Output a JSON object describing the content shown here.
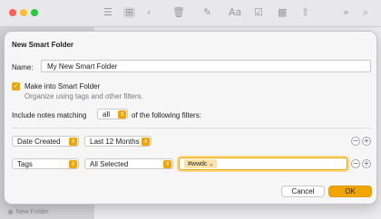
{
  "background": {
    "toolbar_icons": [
      "list-view-icon",
      "gallery-view-icon",
      "back-icon",
      "trash-icon",
      "compose-icon",
      "font-icon",
      "checklist-icon",
      "table-icon",
      "share-icon",
      "more-icon",
      "search-icon"
    ],
    "sidebar_new_folder_label": "New Folder",
    "new_folder_icon_glyph": "⊕"
  },
  "dialog": {
    "title": "New Smart Folder",
    "name_label": "Name:",
    "name_value": "My New Smart Folder",
    "smart_folder_checked": true,
    "smart_folder_label": "Make into Smart Folder",
    "smart_folder_hint": "Organize using tags and other filters.",
    "match_prefix": "Include notes matching",
    "match_value": "all",
    "match_suffix": "of the following filters:",
    "filters": [
      {
        "field": "Date Created",
        "value": "Last 12 Months"
      },
      {
        "field": "Tags",
        "value": "All Selected",
        "tokens": [
          "#wwdc"
        ]
      }
    ],
    "remove_label": "−",
    "add_label": "+",
    "cancel_label": "Cancel",
    "ok_label": "OK",
    "accent_color": "#f0a500"
  }
}
